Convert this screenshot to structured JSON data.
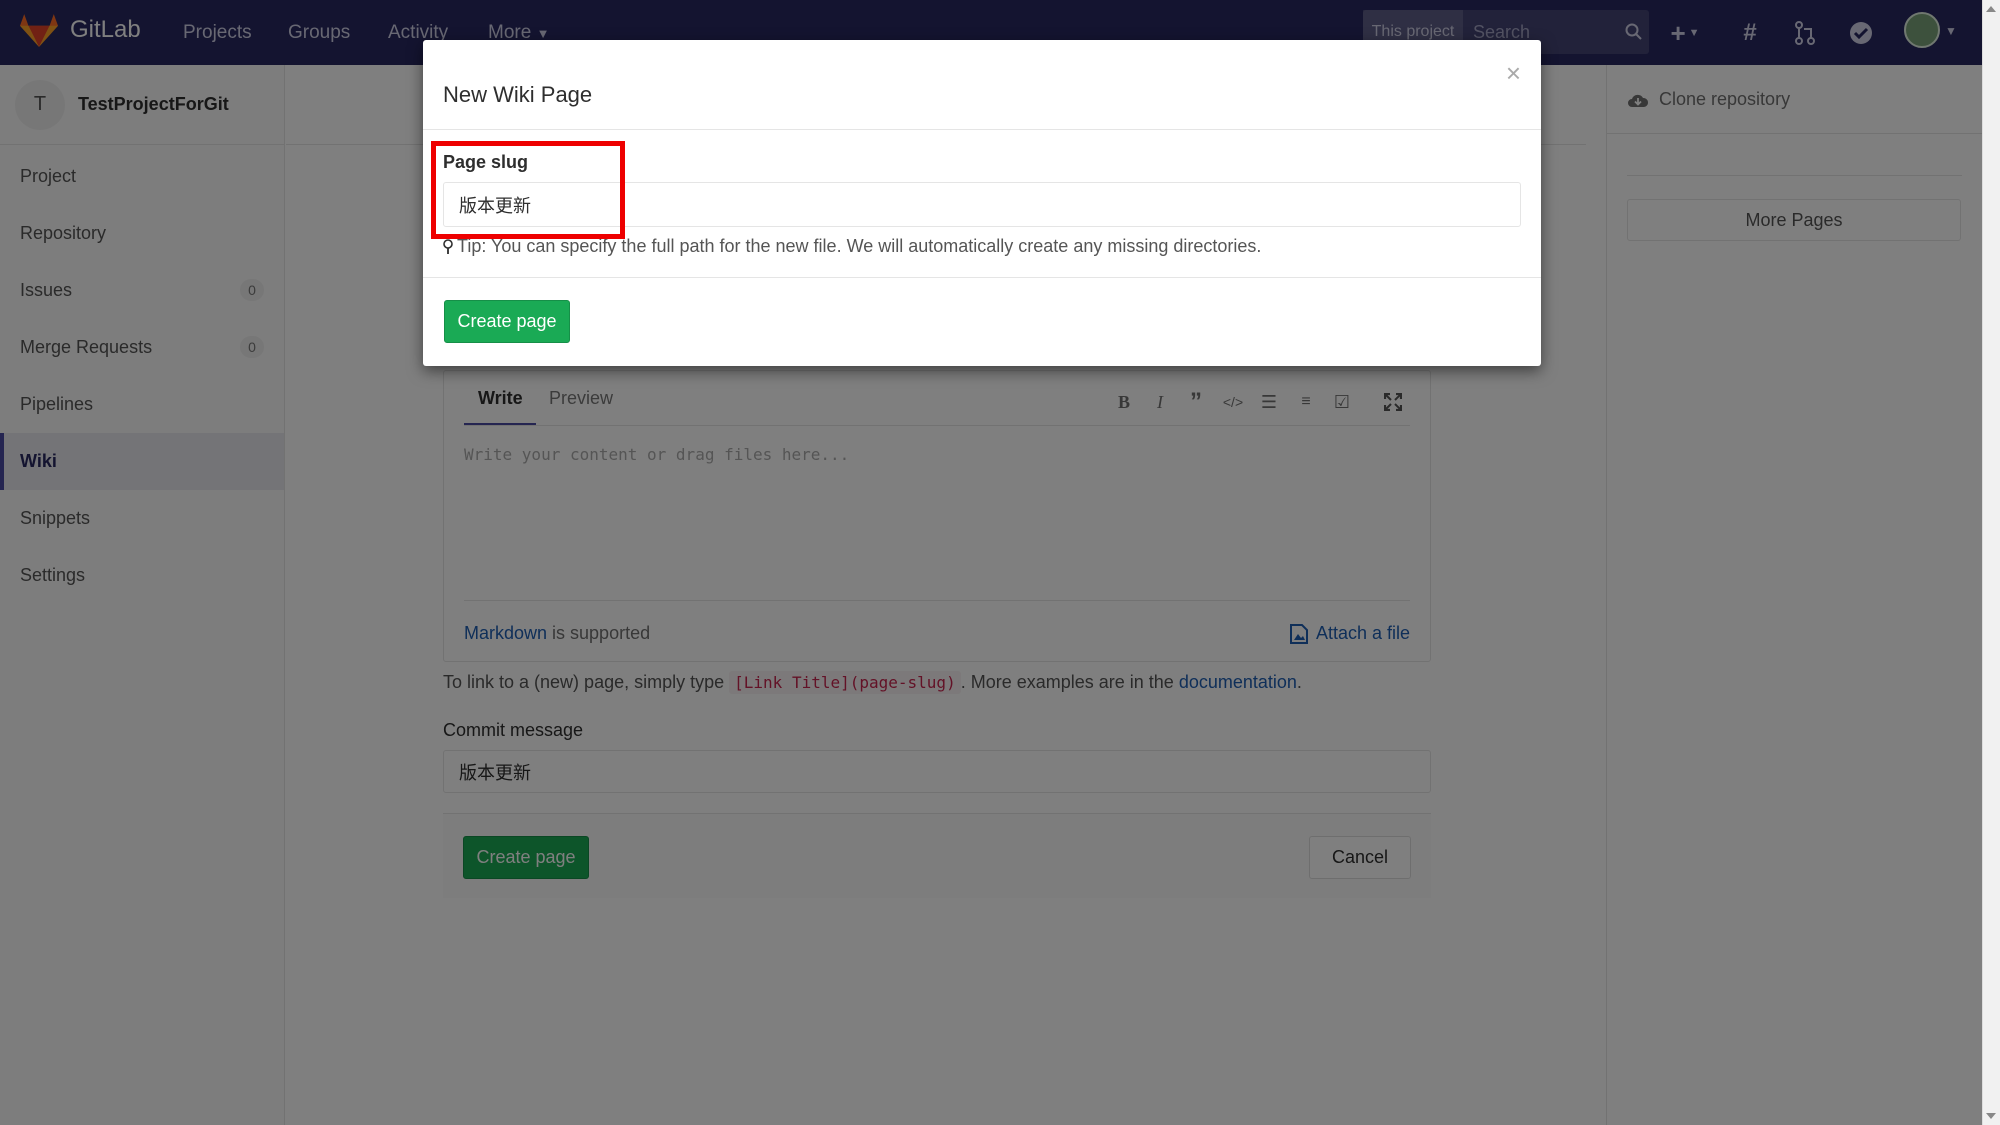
{
  "header": {
    "brand": "GitLab",
    "nav": [
      "Projects",
      "Groups",
      "Activity",
      "More"
    ],
    "search_scope": "This project",
    "search_placeholder": "Search"
  },
  "sidebar": {
    "project_initial": "T",
    "project_name": "TestProjectForGit",
    "items": [
      {
        "label": "Project"
      },
      {
        "label": "Repository"
      },
      {
        "label": "Issues",
        "badge": "0"
      },
      {
        "label": "Merge Requests",
        "badge": "0"
      },
      {
        "label": "Pipelines"
      },
      {
        "label": "Wiki"
      },
      {
        "label": "Snippets"
      },
      {
        "label": "Settings"
      }
    ]
  },
  "editor": {
    "tab_write": "Write",
    "tab_preview": "Preview",
    "placeholder": "Write your content or drag files here...",
    "markdown_link": "Markdown",
    "markdown_suffix": " is supported",
    "attach_label": "Attach a file"
  },
  "help": {
    "prefix": "To link to a (new) page, simply type ",
    "code": "[Link Title](page-slug)",
    "middle": ". More examples are in the ",
    "link": "documentation",
    "suffix": "."
  },
  "commit": {
    "label": "Commit message",
    "value": "版本更新"
  },
  "form": {
    "create_label": "Create page",
    "cancel_label": "Cancel"
  },
  "right_sidebar": {
    "clone_label": "Clone repository",
    "more_pages": "More Pages"
  },
  "modal": {
    "title": "New Wiki Page",
    "close": "×",
    "slug_label": "Page slug",
    "slug_value": "版本更新",
    "tip": "Tip: You can specify the full path for the new file. We will automatically create any missing directories.",
    "create_label": "Create page"
  },
  "colors": {
    "navbar": "#292961",
    "accent_green": "#1aaa55",
    "highlight_red": "#ee0000"
  }
}
